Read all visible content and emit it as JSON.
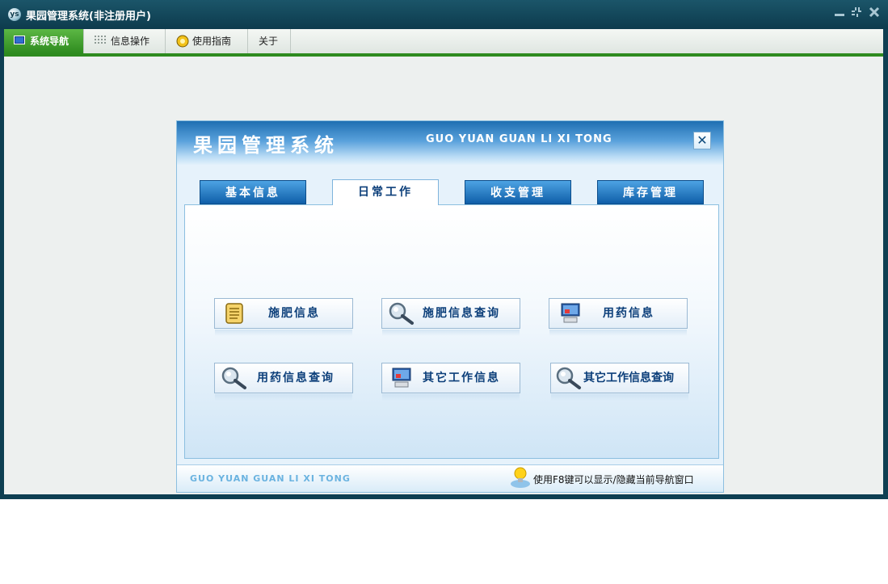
{
  "window": {
    "title": "果园管理系统(非注册用户)",
    "icon_glyph": "ys",
    "controls": [
      "minimize-icon",
      "restore-icon",
      "close-icon"
    ]
  },
  "menubar": {
    "tabs": [
      {
        "label": "系统导航",
        "icon": "monitor-icon",
        "active": true
      },
      {
        "label": "信息操作",
        "icon": "grid-icon",
        "active": false
      },
      {
        "label": "使用指南",
        "icon": "help-icon",
        "active": false
      },
      {
        "label": "关于",
        "icon": "",
        "active": false
      }
    ]
  },
  "dialog": {
    "title": "果园管理系统",
    "subtitle": "GUO YUAN GUAN LI XI TONG",
    "close_glyph": "✕",
    "tabs": [
      {
        "label": "基本信息",
        "active": false
      },
      {
        "label": "日常工作",
        "active": true
      },
      {
        "label": "收支管理",
        "active": false
      },
      {
        "label": "库存管理",
        "active": false
      }
    ],
    "buttons": [
      {
        "label": "施肥信息",
        "icon": "document-icon"
      },
      {
        "label": "施肥信息查询",
        "icon": "magnifier-icon"
      },
      {
        "label": "用药信息",
        "icon": "computer-icon"
      },
      {
        "label": "用药信息查询",
        "icon": "magnifier-icon"
      },
      {
        "label": "其它工作信息",
        "icon": "computer-icon"
      },
      {
        "label": "其它工作信息查询",
        "icon": "magnifier-icon"
      }
    ],
    "footer": {
      "brand": "GUO YUAN GUAN LI XI TONG",
      "hint": "使用F8键可以显示/隐藏当前导航窗口"
    }
  },
  "colors": {
    "window_frame": "#0e3f52",
    "menu_active": "#2e8b1f",
    "tab_blue": "#0f5ea8",
    "label_blue": "#0c3f7a"
  }
}
